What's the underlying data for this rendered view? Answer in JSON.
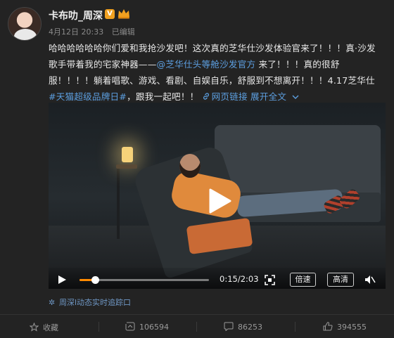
{
  "post": {
    "author": "卡布叻_周深",
    "date": "4月12日 20:33",
    "edited": "已编辑",
    "text_part1": "哈哈哈哈哈哈你们爱和我抢沙发吧！这次真的芝华仕沙发体验官来了！！！真·沙发歌手带着我的宅家神器——",
    "mention": "@芝华仕头等舱沙发官方",
    "text_part2": " 来了！！！真的很舒服！！！！躺着唱歌、游戏、看剧、自娱自乐，舒服到不想离开！！！4.17芝华仕",
    "hashtag": "#天猫超级品牌日#",
    "text_part3": "，跟我一起吧！！",
    "web_link": "网页链接",
    "expand": "展开全文",
    "source": "周深l动态实时追踪口"
  },
  "video": {
    "time": "0:15/2:03",
    "progress": 0.12,
    "speed_label": "倍速",
    "quality_label": "高清"
  },
  "actions": {
    "favorite": "收藏",
    "repost": "106594",
    "comment": "86253",
    "like": "394555"
  },
  "colors": {
    "accent": "#5c9fe0",
    "progress": "#ff8a00",
    "verified": "#f0a020"
  }
}
